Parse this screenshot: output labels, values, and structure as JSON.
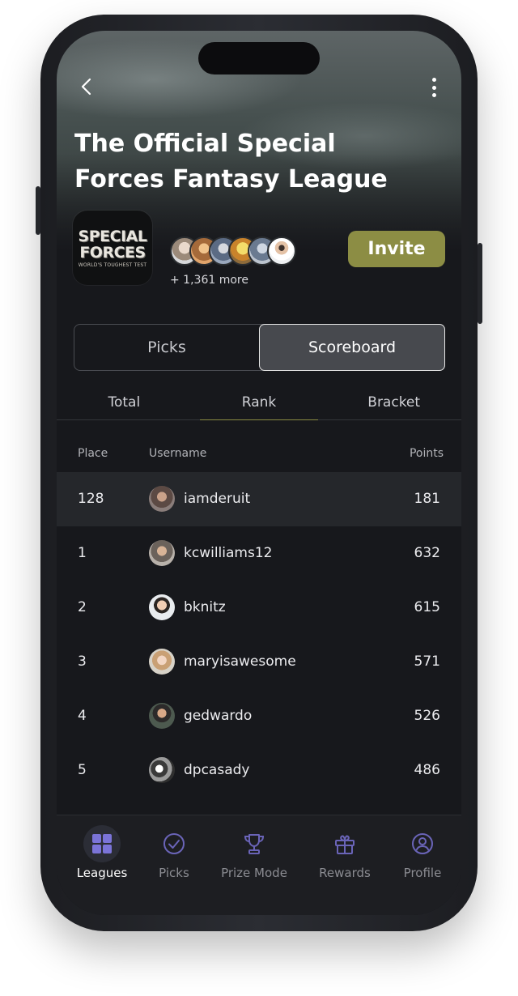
{
  "header": {
    "title": "The Official Special Forces Fantasy League",
    "back_icon": "chevron-left-icon",
    "more_icon": "more-vertical-icon"
  },
  "league_logo": {
    "line1": "SPECIAL",
    "line2": "FORCES",
    "line3": "WORLD'S TOUGHEST TEST"
  },
  "members": {
    "more_text": "+ 1,361 more",
    "avatar_count": 6
  },
  "invite_label": "Invite",
  "segments": [
    {
      "label": "Picks",
      "active": false
    },
    {
      "label": "Scoreboard",
      "active": true
    }
  ],
  "subtabs": [
    {
      "label": "Total",
      "active": false
    },
    {
      "label": "Rank",
      "active": true
    },
    {
      "label": "Bracket",
      "active": false
    }
  ],
  "table": {
    "headers": {
      "place": "Place",
      "username": "Username",
      "points": "Points"
    },
    "rows": [
      {
        "place": "128",
        "username": "iamderuit",
        "points": "181",
        "highlight": true
      },
      {
        "place": "1",
        "username": "kcwilliams12",
        "points": "632",
        "highlight": false
      },
      {
        "place": "2",
        "username": "bknitz",
        "points": "615",
        "highlight": false
      },
      {
        "place": "3",
        "username": "maryisawesome",
        "points": "571",
        "highlight": false
      },
      {
        "place": "4",
        "username": "gedwardo",
        "points": "526",
        "highlight": false
      },
      {
        "place": "5",
        "username": "dpcasady",
        "points": "486",
        "highlight": false
      }
    ]
  },
  "tabbar": [
    {
      "label": "Leagues",
      "icon": "grid-icon",
      "active": true
    },
    {
      "label": "Picks",
      "icon": "check-circle-icon",
      "active": false
    },
    {
      "label": "Prize Mode",
      "icon": "trophy-icon",
      "active": false
    },
    {
      "label": "Rewards",
      "icon": "gift-icon",
      "active": false
    },
    {
      "label": "Profile",
      "icon": "user-circle-icon",
      "active": false
    }
  ],
  "colors": {
    "accent": "#8c8d44",
    "tab_icon_active": "#7b74d8",
    "background": "#17181c"
  }
}
